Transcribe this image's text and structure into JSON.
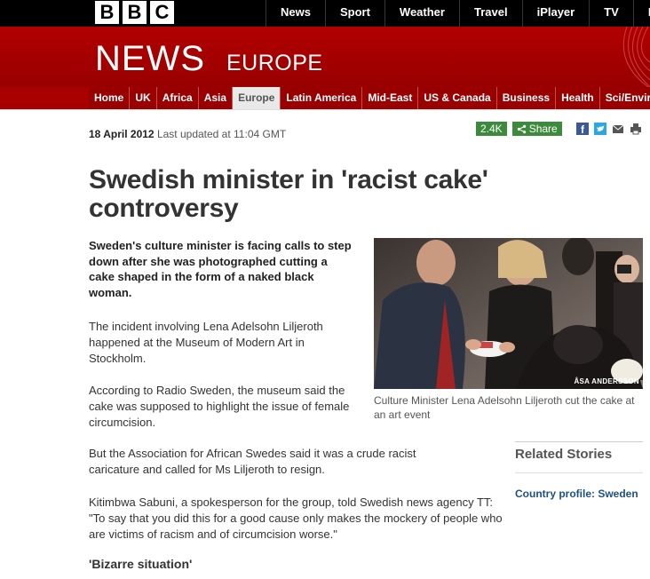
{
  "brand": {
    "logo_letters": [
      "B",
      "B",
      "C"
    ]
  },
  "top_nav": {
    "items": [
      "News",
      "Sport",
      "Weather",
      "Travel",
      "iPlayer",
      "TV",
      "R"
    ]
  },
  "banner": {
    "title": "NEWS",
    "subtitle": "EUROPE"
  },
  "section_nav": {
    "items": [
      "Home",
      "UK",
      "Africa",
      "Asia",
      "Europe",
      "Latin America",
      "Mid-East",
      "US & Canada",
      "Business",
      "Health",
      "Sci/Enviro"
    ],
    "active": "Europe"
  },
  "article": {
    "date": "18 April 2012",
    "updated": "Last updated at 11:04 GMT",
    "headline": "Swedish minister in 'racist cake' controversy",
    "intro": "Sweden's culture minister is facing calls to step down after she was photographed cutting a cake shaped in the form of a naked black woman.",
    "paragraphs": [
      "The incident involving Lena Adelsohn Liljeroth happened at the Museum of Modern Art in Stockholm.",
      "According to Radio Sweden, the museum said the cake was supposed to highlight the issue of female circumcision.",
      "But the Association for African Swedes said it was a crude racist caricature and called for Ms Liljeroth to resign.",
      "Kitimbwa Sabuni, a spokesperson for the group, told Swedish news agency TT: \"To say that you did this for a good cause only makes the mockery of people who are victims of racism and of circumcision worse.\""
    ],
    "subheading": "'Bizarre situation'"
  },
  "share": {
    "count": "2.4K",
    "label": "Share",
    "icons": [
      "facebook-icon",
      "twitter-icon",
      "email-icon",
      "print-icon"
    ]
  },
  "photo": {
    "credit": "ÅSA ANDERSSON",
    "caption": "Culture Minister Lena Adelsohn Liljeroth cut the cake at an art event"
  },
  "related": {
    "title": "Related Stories",
    "links": [
      "Country profile: Sweden"
    ]
  },
  "colors": {
    "bbc_red": "#a50000",
    "share_green": "#3c8b3c",
    "link_blue": "#1f4f82"
  }
}
